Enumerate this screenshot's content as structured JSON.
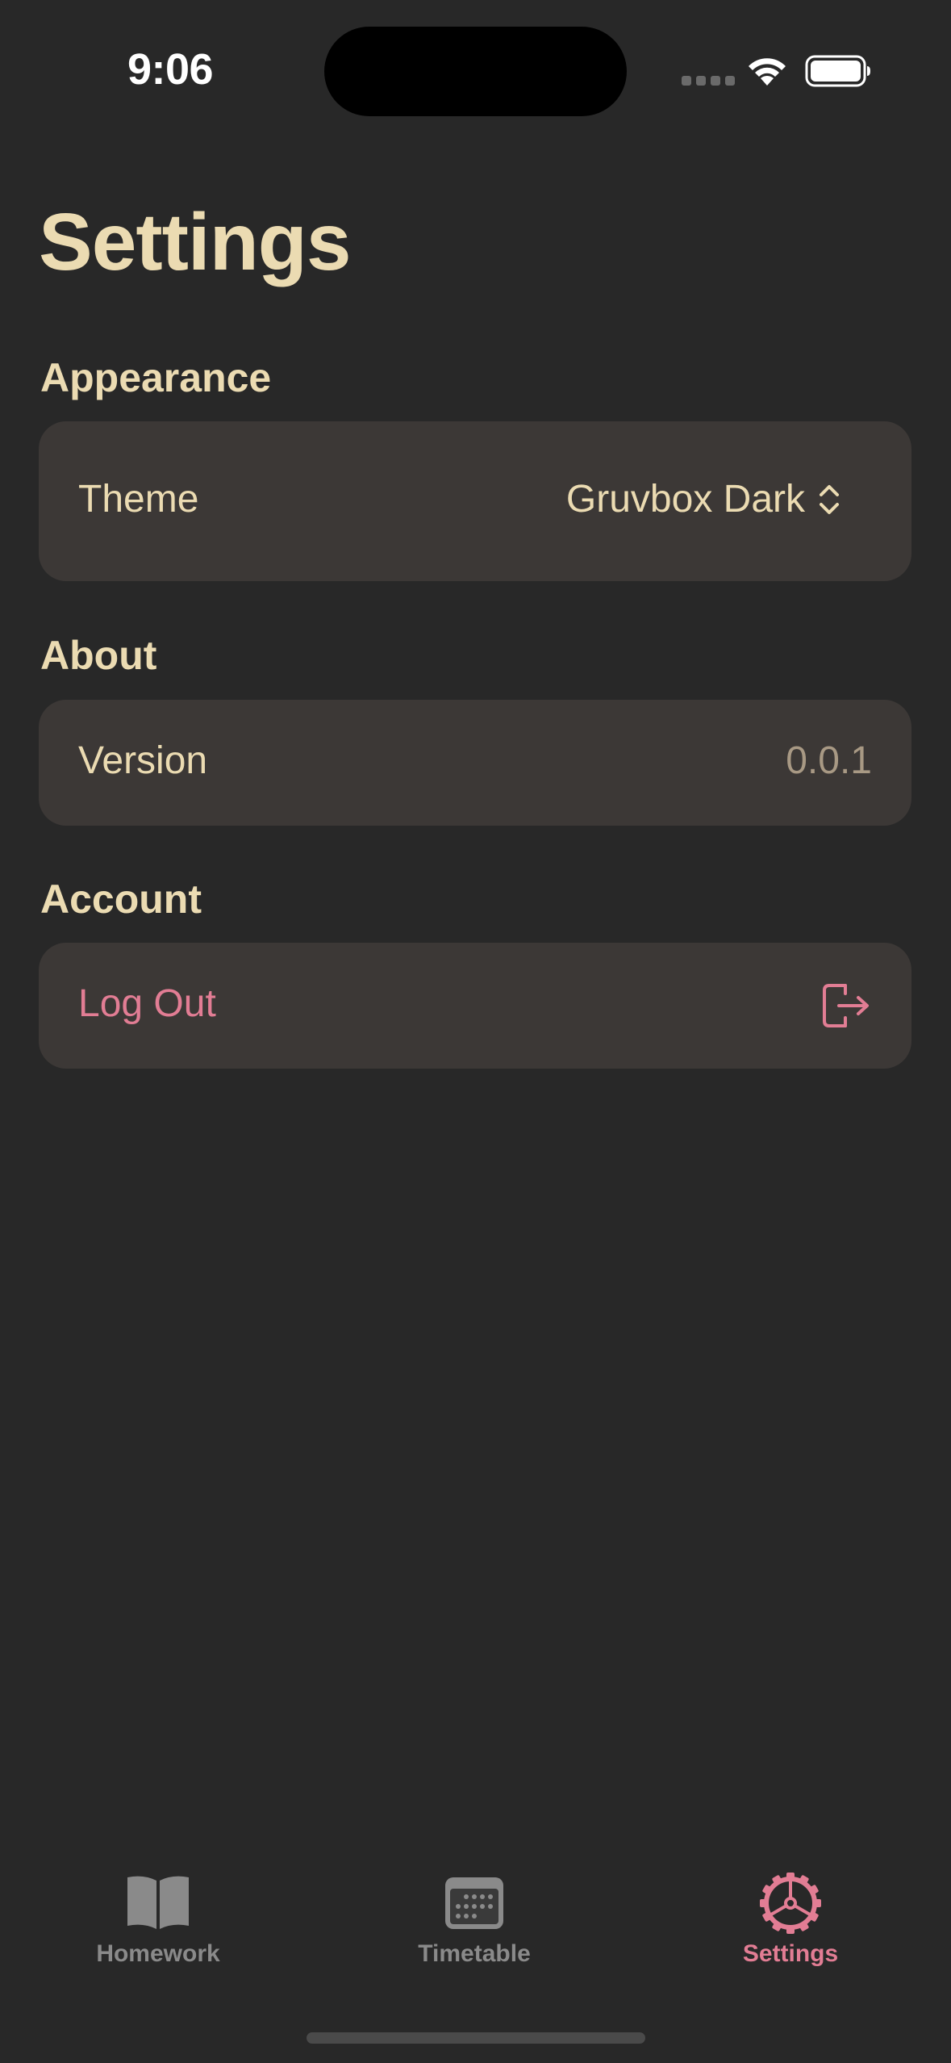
{
  "status_bar": {
    "time": "9:06"
  },
  "page": {
    "title": "Settings"
  },
  "sections": {
    "appearance": {
      "header": "Appearance",
      "theme_label": "Theme",
      "theme_value": "Gruvbox Dark"
    },
    "about": {
      "header": "About",
      "version_label": "Version",
      "version_value": "0.0.1"
    },
    "account": {
      "header": "Account",
      "logout_label": "Log Out"
    }
  },
  "tab_bar": {
    "items": [
      {
        "label": "Homework",
        "icon": "book-icon",
        "selected": false
      },
      {
        "label": "Timetable",
        "icon": "calendar-icon",
        "selected": false
      },
      {
        "label": "Settings",
        "icon": "gear-icon",
        "selected": true
      }
    ]
  },
  "colors": {
    "background": "#282828",
    "card": "#3c3836",
    "text_primary": "#ebdbb2",
    "text_secondary": "#a89984",
    "accent": "#e27d94",
    "tab_inactive": "#8a8a8a"
  }
}
